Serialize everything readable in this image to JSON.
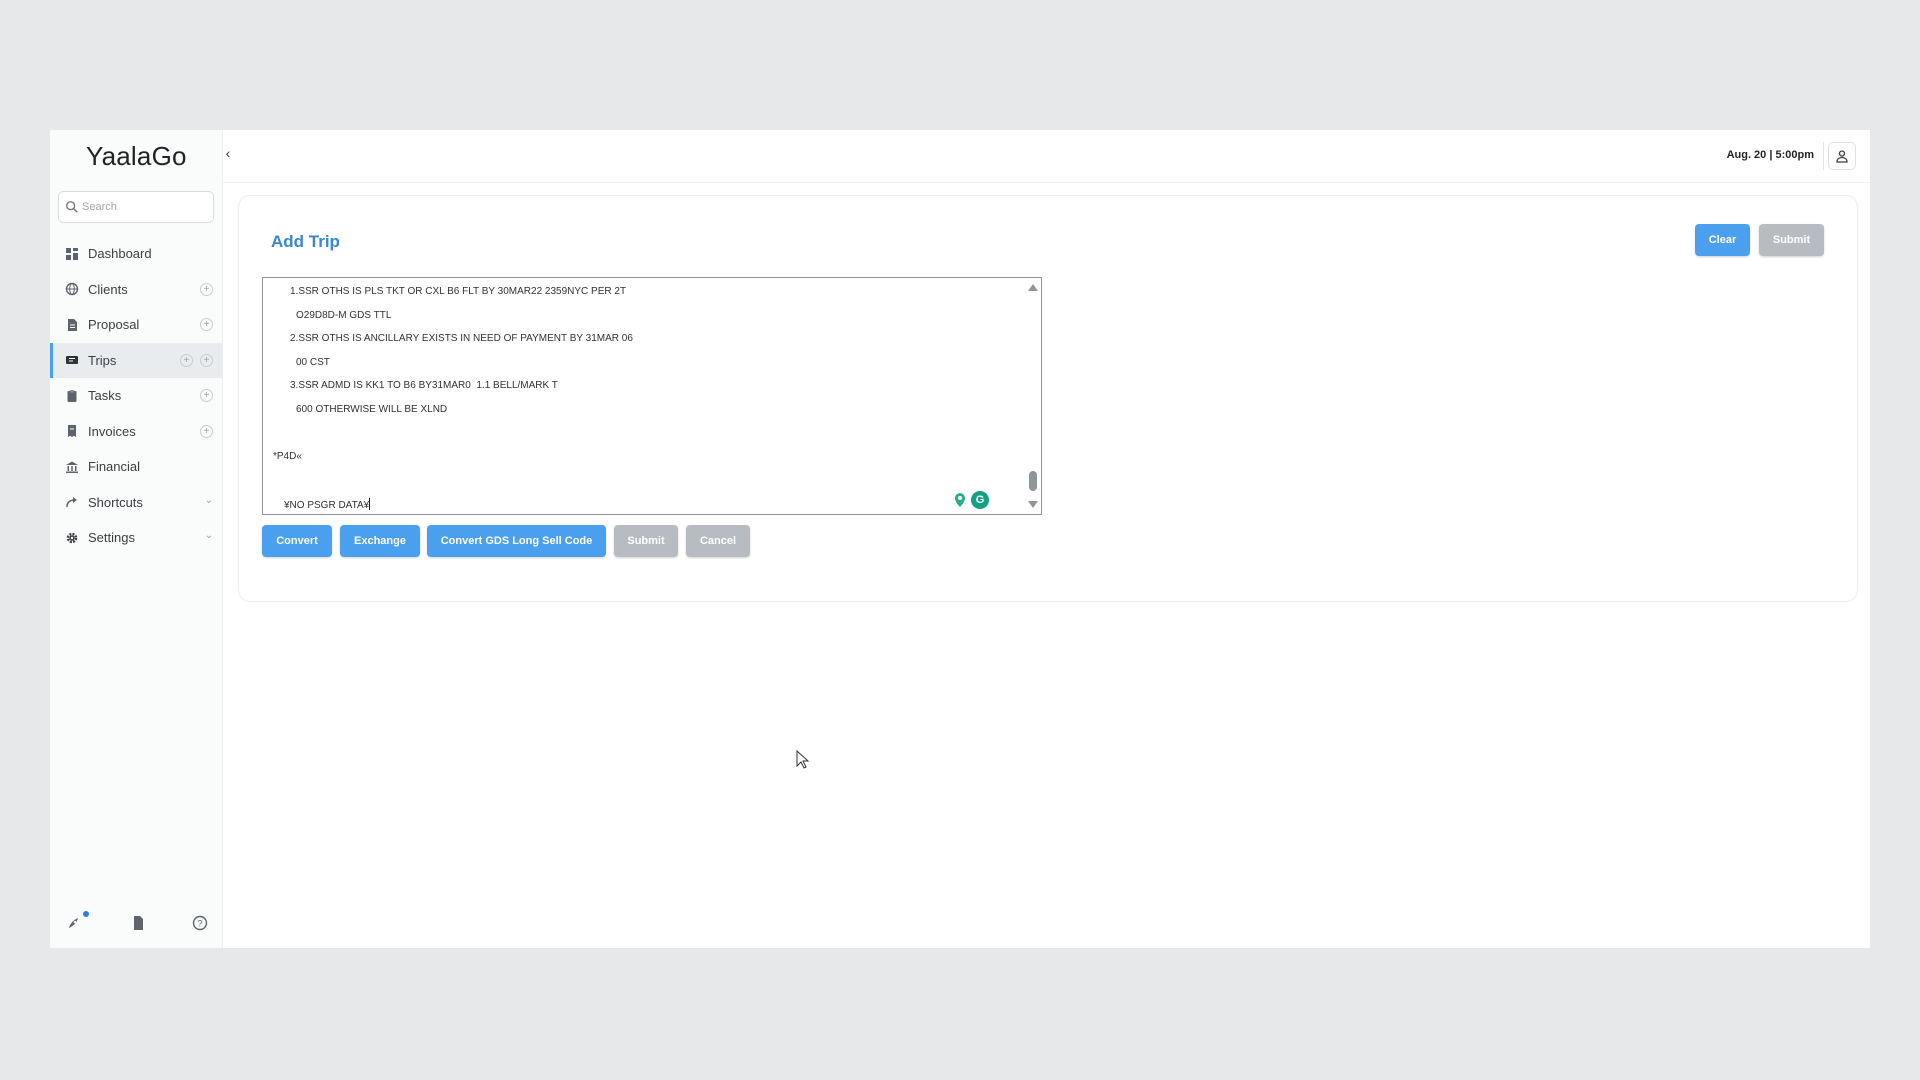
{
  "app": {
    "name": "YaalaGo",
    "collapse_icon": "chevron-left-icon"
  },
  "search": {
    "placeholder": "Search",
    "icon": "search-icon"
  },
  "sidebar": {
    "items": [
      {
        "label": "Dashboard",
        "icon": "dashboard-icon"
      },
      {
        "label": "Clients",
        "icon": "globe-icon",
        "add": true
      },
      {
        "label": "Proposal",
        "icon": "file-icon",
        "add": true
      },
      {
        "label": "Trips",
        "icon": "ticket-icon",
        "add": true,
        "active": true
      },
      {
        "label": "Tasks",
        "icon": "clipboard-icon",
        "add": true
      },
      {
        "label": "Invoices",
        "icon": "invoice-icon",
        "add": true
      },
      {
        "label": "Financial",
        "icon": "bank-icon"
      },
      {
        "label": "Shortcuts",
        "icon": "share-icon",
        "expand": true
      },
      {
        "label": "Settings",
        "icon": "gear-icon",
        "expand": true
      }
    ],
    "footer_icons": [
      "rocket-icon",
      "document-icon",
      "help-icon"
    ]
  },
  "topbar": {
    "datetime": "Aug. 20 | 5:00pm",
    "user_icon": "user-icon"
  },
  "page": {
    "title": "Add Trip",
    "header_buttons": {
      "clear": "Clear",
      "submit": "Submit"
    },
    "editor_lines": [
      "1.SSR OTHS IS PLS TKT OR CXL B6 FLT BY 30MAR22 2359NYC PER 2T",
      "O29D8D-M GDS TTL",
      "2.SSR OTHS IS ANCILLARY EXISTS IN NEED OF PAYMENT BY 31MAR 06",
      "00 CST",
      "3.SSR ADMD IS KK1 TO B6 BY31MAR0  1.1 BELL/MARK T",
      "600 OTHERWISE WILL BE XLND",
      "*P4D«",
      "¥NO PSGR DATA¥"
    ],
    "action_buttons": {
      "convert": "Convert",
      "exchange": "Exchange",
      "convert_gds": "Convert GDS Long Sell Code",
      "submit": "Submit",
      "cancel": "Cancel"
    },
    "grammarly_label": "G"
  },
  "colors": {
    "accent": "#4a9fef",
    "title": "#3a86cf",
    "disabled": "#b7bcc2",
    "active_bar": "#4a9eea"
  }
}
